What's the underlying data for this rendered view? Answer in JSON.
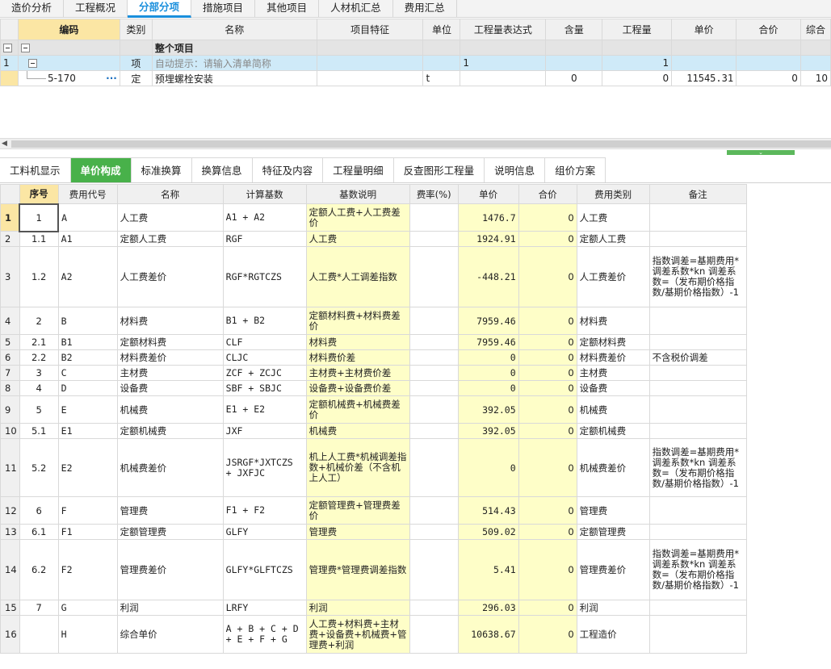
{
  "top_tabs": [
    "造价分析",
    "工程概况",
    "分部分项",
    "措施项目",
    "其他项目",
    "人材机汇总",
    "费用汇总"
  ],
  "top_active": 2,
  "upper_grid": {
    "headers": [
      "",
      "编码",
      "类别",
      "名称",
      "项目特征",
      "单位",
      "工程量表达式",
      "含量",
      "工程量",
      "单价",
      "合价",
      "综合"
    ],
    "group_row": {
      "name": "整个项目"
    },
    "sel_row": {
      "rn": "1",
      "type": "项",
      "name": "自动提示：请输入清单简称",
      "expr": "1",
      "qty": "1"
    },
    "item_row": {
      "code": "5-170",
      "dots": "···",
      "type": "定",
      "name": "预埋螺栓安装",
      "unit": "t",
      "content": "0",
      "qty": "0",
      "price": "11545.31",
      "total": "0",
      "comp": "10"
    }
  },
  "lower_tabs": [
    "工料机显示",
    "单价构成",
    "标准换算",
    "换算信息",
    "特征及内容",
    "工程量明细",
    "反查图形工程量",
    "说明信息",
    "组价方案"
  ],
  "lower_active": 1,
  "lower_grid": {
    "headers": [
      "",
      "序号",
      "费用代号",
      "名称",
      "计算基数",
      "基数说明",
      "费率(%)",
      "单价",
      "合价",
      "费用类别",
      "备注"
    ],
    "rows": [
      {
        "rn": "1",
        "seq": "1",
        "code": "A",
        "name": "人工费",
        "base": "A1 + A2",
        "desc": "定额人工费+人工费差价",
        "rate": "",
        "price": "1476.7",
        "total": "0",
        "cat": "人工费",
        "note": ""
      },
      {
        "rn": "2",
        "seq": "1.1",
        "code": "A1",
        "name": "定额人工费",
        "base": "RGF",
        "desc": "人工费",
        "rate": "",
        "price": "1924.91",
        "total": "0",
        "cat": "定额人工费",
        "note": ""
      },
      {
        "rn": "3",
        "seq": "1.2",
        "code": "A2",
        "name": "人工费差价",
        "base": "RGF*RGTCZS",
        "desc": "人工费*人工调差指数",
        "rate": "",
        "price": "-448.21",
        "total": "0",
        "cat": "人工费差价",
        "note": "指数调差=基期费用*调差系数*kn 调差系数=（发布期价格指数/基期价格指数）-1"
      },
      {
        "rn": "4",
        "seq": "2",
        "code": "B",
        "name": "材料费",
        "base": "B1 + B2",
        "desc": "定额材料费+材料费差价",
        "rate": "",
        "price": "7959.46",
        "total": "0",
        "cat": "材料费",
        "note": ""
      },
      {
        "rn": "5",
        "seq": "2.1",
        "code": "B1",
        "name": "定额材料费",
        "base": "CLF",
        "desc": "材料费",
        "rate": "",
        "price": "7959.46",
        "total": "0",
        "cat": "定额材料费",
        "note": ""
      },
      {
        "rn": "6",
        "seq": "2.2",
        "code": "B2",
        "name": "材料费差价",
        "base": "CLJC",
        "desc": "材料费价差",
        "rate": "",
        "price": "0",
        "total": "0",
        "cat": "材料费差价",
        "note": "不含税价调差"
      },
      {
        "rn": "7",
        "seq": "3",
        "code": "C",
        "name": "主材费",
        "base": "ZCF + ZCJC",
        "desc": "主材费+主材费价差",
        "rate": "",
        "price": "0",
        "total": "0",
        "cat": "主材费",
        "note": ""
      },
      {
        "rn": "8",
        "seq": "4",
        "code": "D",
        "name": "设备费",
        "base": "SBF + SBJC",
        "desc": "设备费+设备费价差",
        "rate": "",
        "price": "0",
        "total": "0",
        "cat": "设备费",
        "note": ""
      },
      {
        "rn": "9",
        "seq": "5",
        "code": "E",
        "name": "机械费",
        "base": "E1 + E2",
        "desc": "定额机械费+机械费差价",
        "rate": "",
        "price": "392.05",
        "total": "0",
        "cat": "机械费",
        "note": ""
      },
      {
        "rn": "10",
        "seq": "5.1",
        "code": "E1",
        "name": "定额机械费",
        "base": "JXF",
        "desc": "机械费",
        "rate": "",
        "price": "392.05",
        "total": "0",
        "cat": "定额机械费",
        "note": ""
      },
      {
        "rn": "11",
        "seq": "5.2",
        "code": "E2",
        "name": "机械费差价",
        "base": "JSRGF*JXTCZS + JXFJC",
        "desc": "机上人工费*机械调差指数+机械价差（不含机上人工）",
        "rate": "",
        "price": "0",
        "total": "0",
        "cat": "机械费差价",
        "note": "指数调差=基期费用*调差系数*kn 调差系数=（发布期价格指数/基期价格指数）-1"
      },
      {
        "rn": "12",
        "seq": "6",
        "code": "F",
        "name": "管理费",
        "base": "F1 + F2",
        "desc": "定额管理费+管理费差价",
        "rate": "",
        "price": "514.43",
        "total": "0",
        "cat": "管理费",
        "note": ""
      },
      {
        "rn": "13",
        "seq": "6.1",
        "code": "F1",
        "name": "定额管理费",
        "base": "GLFY",
        "desc": "管理费",
        "rate": "",
        "price": "509.02",
        "total": "0",
        "cat": "定额管理费",
        "note": ""
      },
      {
        "rn": "14",
        "seq": "6.2",
        "code": "F2",
        "name": "管理费差价",
        "base": "GLFY*GLFTCZS",
        "desc": "管理费*管理费调差指数",
        "rate": "",
        "price": "5.41",
        "total": "0",
        "cat": "管理费差价",
        "note": "指数调差=基期费用*调差系数*kn 调差系数=（发布期价格指数/基期价格指数）-1"
      },
      {
        "rn": "15",
        "seq": "7",
        "code": "G",
        "name": "利润",
        "base": "LRFY",
        "desc": "利润",
        "rate": "",
        "price": "296.03",
        "total": "0",
        "cat": "利润",
        "note": ""
      },
      {
        "rn": "16",
        "seq": "",
        "code": "H",
        "name": "综合单价",
        "base": "A + B + C + D + E + F + G",
        "desc": "人工费+材料费+主材费+设备费+机械费+管理费+利润",
        "rate": "",
        "price": "10638.67",
        "total": "0",
        "cat": "工程造价",
        "note": ""
      }
    ]
  }
}
